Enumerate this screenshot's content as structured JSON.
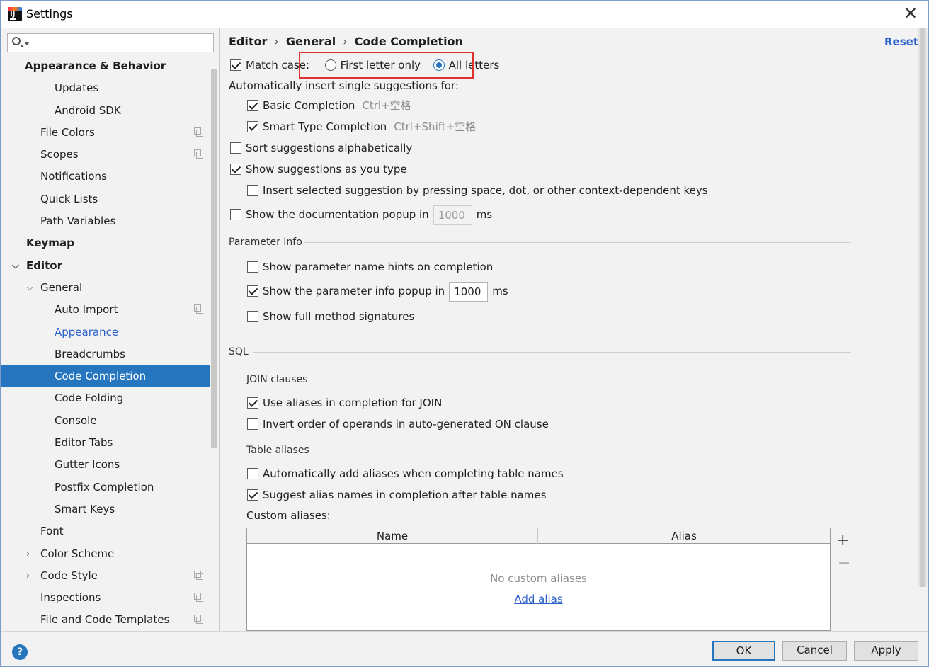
{
  "window": {
    "title": "Settings"
  },
  "sidebar": {
    "search_placeholder": "",
    "items": [
      {
        "label": "Appearance & Behavior",
        "bold": true
      },
      {
        "label": "Updates"
      },
      {
        "label": "Android SDK"
      },
      {
        "label": "File Colors"
      },
      {
        "label": "Scopes"
      },
      {
        "label": "Notifications"
      },
      {
        "label": "Quick Lists"
      },
      {
        "label": "Path Variables"
      },
      {
        "label": "Keymap",
        "bold": true
      },
      {
        "label": "Editor",
        "bold": true
      },
      {
        "label": "General"
      },
      {
        "label": "Auto Import"
      },
      {
        "label": "Appearance"
      },
      {
        "label": "Breadcrumbs"
      },
      {
        "label": "Code Completion",
        "selected": true
      },
      {
        "label": "Code Folding"
      },
      {
        "label": "Console"
      },
      {
        "label": "Editor Tabs"
      },
      {
        "label": "Gutter Icons"
      },
      {
        "label": "Postfix Completion"
      },
      {
        "label": "Smart Keys"
      },
      {
        "label": "Font"
      },
      {
        "label": "Color Scheme"
      },
      {
        "label": "Code Style"
      },
      {
        "label": "Inspections"
      },
      {
        "label": "File and Code Templates"
      }
    ]
  },
  "breadcrumb": {
    "items": [
      "Editor",
      "General",
      "Code Completion"
    ],
    "separator": "›"
  },
  "reset_label": "Reset",
  "options": {
    "match_case": {
      "label": "Match case:",
      "checked": true
    },
    "first_letter_only": {
      "label": "First letter only",
      "selected": false
    },
    "all_letters": {
      "label": "All letters",
      "selected": true
    },
    "auto_insert_label": "Automatically insert single suggestions for:",
    "basic_completion": {
      "label": "Basic Completion",
      "shortcut": "Ctrl+空格",
      "checked": true
    },
    "smart_type_completion": {
      "label": "Smart Type Completion",
      "shortcut": "Ctrl+Shift+空格",
      "checked": true
    },
    "sort_alpha": {
      "label": "Sort suggestions alphabetically",
      "checked": false
    },
    "show_as_type": {
      "label": "Show suggestions as you type",
      "checked": true
    },
    "insert_by_space": {
      "label": "Insert selected suggestion by pressing space, dot, or other context-dependent keys",
      "checked": false
    },
    "doc_popup": {
      "label": "Show the documentation popup in",
      "value": "1000",
      "unit": "ms",
      "checked": false
    }
  },
  "parameter_info": {
    "title": "Parameter Info",
    "name_hints": {
      "label": "Show parameter name hints on completion",
      "checked": false
    },
    "info_popup": {
      "label": "Show the parameter info popup in",
      "value": "1000",
      "unit": "ms",
      "checked": true
    },
    "full_signatures": {
      "label": "Show full method signatures",
      "checked": false
    }
  },
  "sql": {
    "title": "SQL",
    "join_title": "JOIN clauses",
    "use_aliases_join": {
      "label": "Use aliases in completion for JOIN",
      "checked": true
    },
    "invert_operands": {
      "label": "Invert order of operands in auto-generated ON clause",
      "checked": false
    },
    "table_aliases_title": "Table aliases",
    "auto_add_aliases": {
      "label": "Automatically add aliases when completing table names",
      "checked": false
    },
    "suggest_alias_names": {
      "label": "Suggest alias names in completion after table names",
      "checked": true
    },
    "custom_aliases_label": "Custom aliases:",
    "table": {
      "columns": [
        "Name",
        "Alias"
      ],
      "empty_text": "No custom aliases",
      "add_link": "Add alias",
      "add_symbol": "+",
      "remove_symbol": "−"
    }
  },
  "footer": {
    "help": "?",
    "ok": "OK",
    "cancel": "Cancel",
    "apply": "Apply"
  },
  "colors": {
    "accent": "#2675bf",
    "link": "#2b61c9",
    "highlight_box": "#e03131"
  }
}
